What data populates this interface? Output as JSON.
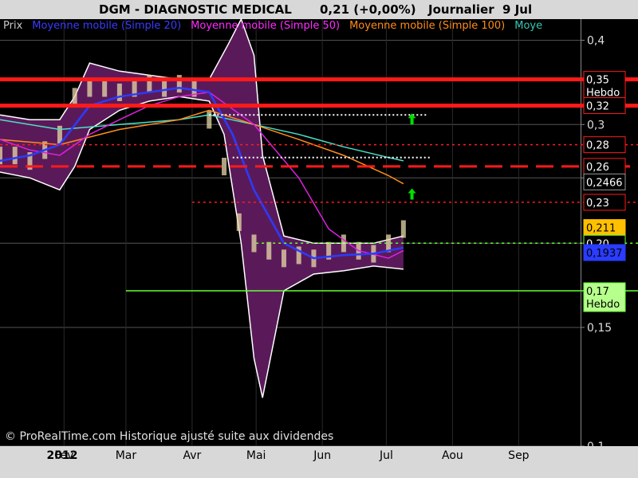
{
  "header": {
    "symbol": "DGM - DIAGNOSTIC MEDICAL",
    "price": "0,21 (+0,00%)",
    "period": "Journalier  9 Jul"
  },
  "legend": [
    {
      "label": "Prix",
      "color": "#c8c8c8"
    },
    {
      "label": "Moyenne mobile (Simple 20)",
      "color": "#3a3aff"
    },
    {
      "label": "Moyenne mobile (Simple 50)",
      "color": "#ff2dff"
    },
    {
      "label": "Moyenne mobile (Simple 100)",
      "color": "#ff8c1a"
    },
    {
      "label": "Moye",
      "color": "#33c8b4"
    }
  ],
  "watermark": "© ProRealTime.com Historique ajusté suite aux dividendes",
  "colors": {
    "band_fill": "#5a1a5a",
    "price_bars": "#e8d9a8",
    "sma20": "#2a3cff",
    "sma50": "#e020e0",
    "sma100": "#ff8c1a",
    "sma200": "#4ae0c8",
    "resistance": "#ff1a1a",
    "support": "#66ff33",
    "arrow": "#00e000"
  },
  "chart_data": {
    "type": "line",
    "title": "DGM - DIAGNOSTIC MEDICAL",
    "scale": "log",
    "ylim": [
      0.1,
      0.43
    ],
    "xlim": [
      "2012-01-02",
      "2012-09-30"
    ],
    "x_ticks": [
      {
        "label": "2012",
        "date": "2012-01-02",
        "bold": true
      },
      {
        "label": "Fev",
        "date": "2012-02-01"
      },
      {
        "label": "Mar",
        "date": "2012-03-01"
      },
      {
        "label": "Avr",
        "date": "2012-04-01"
      },
      {
        "label": "Mai",
        "date": "2012-05-01"
      },
      {
        "label": "Jun",
        "date": "2012-06-01"
      },
      {
        "label": "Jul",
        "date": "2012-07-01"
      },
      {
        "label": "Aou",
        "date": "2012-08-01"
      },
      {
        "label": "Sep",
        "date": "2012-09-01"
      }
    ],
    "y_ticks": [
      "0,1",
      "0,15",
      "0,2",
      "0,25",
      "0,3",
      "0,35",
      "0,4"
    ],
    "y_tick_values": [
      0.1,
      0.15,
      0.2,
      0.25,
      0.3,
      0.35,
      0.4
    ],
    "price": {
      "x": [
        "2012-01-02",
        "2012-01-09",
        "2012-01-16",
        "2012-01-23",
        "2012-01-30",
        "2012-02-06",
        "2012-02-13",
        "2012-02-20",
        "2012-02-27",
        "2012-03-05",
        "2012-03-12",
        "2012-03-19",
        "2012-03-26",
        "2012-04-02",
        "2012-04-09",
        "2012-04-16",
        "2012-04-23",
        "2012-04-30",
        "2012-05-07",
        "2012-05-14",
        "2012-05-21",
        "2012-05-28",
        "2012-06-04",
        "2012-06-11",
        "2012-06-18",
        "2012-06-25",
        "2012-07-02",
        "2012-07-09"
      ],
      "close": [
        0.27,
        0.27,
        0.265,
        0.275,
        0.29,
        0.33,
        0.34,
        0.34,
        0.335,
        0.34,
        0.345,
        0.34,
        0.345,
        0.34,
        0.305,
        0.26,
        0.215,
        0.2,
        0.195,
        0.19,
        0.192,
        0.19,
        0.195,
        0.2,
        0.195,
        0.193,
        0.2,
        0.21
      ]
    },
    "series": [
      {
        "name": "Moyenne mobile (Simple 20)",
        "color": "#2a3cff",
        "x": [
          "2012-01-02",
          "2012-01-16",
          "2012-01-30",
          "2012-02-13",
          "2012-02-27",
          "2012-03-12",
          "2012-03-26",
          "2012-04-09",
          "2012-04-20",
          "2012-04-30",
          "2012-05-14",
          "2012-05-28",
          "2012-06-11",
          "2012-06-25",
          "2012-07-09"
        ],
        "values": [
          0.265,
          0.27,
          0.28,
          0.32,
          0.33,
          0.335,
          0.34,
          0.335,
          0.29,
          0.24,
          0.2,
          0.19,
          0.192,
          0.193,
          0.197
        ]
      },
      {
        "name": "Moyenne mobile (Simple 50)",
        "color": "#e020e0",
        "x": [
          "2012-01-02",
          "2012-01-16",
          "2012-01-30",
          "2012-02-13",
          "2012-02-27",
          "2012-03-12",
          "2012-03-26",
          "2012-04-09",
          "2012-04-30",
          "2012-05-21",
          "2012-06-04",
          "2012-06-18",
          "2012-07-02",
          "2012-07-09"
        ],
        "values": [
          0.285,
          0.275,
          0.27,
          0.29,
          0.305,
          0.32,
          0.33,
          0.335,
          0.3,
          0.25,
          0.21,
          0.195,
          0.19,
          0.195
        ]
      },
      {
        "name": "Moyenne mobile (Simple 100)",
        "color": "#ff8c1a",
        "x": [
          "2012-01-02",
          "2012-01-30",
          "2012-02-27",
          "2012-03-26",
          "2012-04-09",
          "2012-04-30",
          "2012-05-21",
          "2012-06-11",
          "2012-07-02",
          "2012-07-09"
        ],
        "values": [
          0.285,
          0.28,
          0.295,
          0.305,
          0.315,
          0.3,
          0.285,
          0.27,
          0.252,
          0.245
        ]
      },
      {
        "name": "Moye",
        "color": "#4ae0c8",
        "x": [
          "2012-01-02",
          "2012-01-30",
          "2012-02-27",
          "2012-03-26",
          "2012-04-09",
          "2012-04-30",
          "2012-05-21",
          "2012-06-11",
          "2012-07-02",
          "2012-07-09"
        ],
        "values": [
          0.305,
          0.295,
          0.3,
          0.305,
          0.31,
          0.3,
          0.29,
          0.278,
          0.268,
          0.265
        ]
      }
    ],
    "bollinger_upper": {
      "x": [
        "2012-01-02",
        "2012-01-16",
        "2012-01-30",
        "2012-02-06",
        "2012-02-13",
        "2012-02-27",
        "2012-03-12",
        "2012-03-26",
        "2012-04-09",
        "2012-04-18",
        "2012-04-24",
        "2012-04-30",
        "2012-05-04",
        "2012-05-14",
        "2012-05-28",
        "2012-06-11",
        "2012-06-25",
        "2012-07-09"
      ],
      "values": [
        0.31,
        0.305,
        0.305,
        0.33,
        0.37,
        0.36,
        0.355,
        0.35,
        0.35,
        0.395,
        0.43,
        0.38,
        0.27,
        0.205,
        0.2,
        0.2,
        0.2,
        0.205
      ]
    },
    "bollinger_lower": {
      "x": [
        "2012-01-02",
        "2012-01-16",
        "2012-01-30",
        "2012-02-06",
        "2012-02-13",
        "2012-02-27",
        "2012-03-12",
        "2012-03-26",
        "2012-04-09",
        "2012-04-16",
        "2012-04-24",
        "2012-04-30",
        "2012-05-04",
        "2012-05-14",
        "2012-05-28",
        "2012-06-11",
        "2012-06-25",
        "2012-07-09"
      ],
      "values": [
        0.255,
        0.25,
        0.24,
        0.26,
        0.295,
        0.315,
        0.325,
        0.33,
        0.325,
        0.29,
        0.2,
        0.135,
        0.118,
        0.17,
        0.18,
        0.182,
        0.185,
        0.183
      ]
    },
    "levels": [
      {
        "value": 0.35,
        "label": "0,35 Hebdo",
        "style": "solid",
        "color": "#ff1a1a",
        "bg": "#000000",
        "fg": "#ffffff"
      },
      {
        "value": 0.32,
        "label": "0,32",
        "style": "solid",
        "color": "#ff1a1a",
        "bg": "#000000",
        "fg": "#ffffff"
      },
      {
        "value": 0.28,
        "label": "0,28",
        "style": "dotted",
        "color": "#ff1a1a",
        "bg": "#000000",
        "fg": "#ffffff"
      },
      {
        "value": 0.26,
        "label": "0,26 Hebdo",
        "style": "dashed",
        "color": "#ff1a1a",
        "bg": "#000000",
        "fg": "#ffffff"
      },
      {
        "value": 0.2466,
        "label": "0,2466",
        "style": "none",
        "color": "#999999",
        "bg": "#000000",
        "fg": "#ffffff"
      },
      {
        "value": 0.23,
        "label": "0,23",
        "style": "dotted",
        "color": "#ff1a1a",
        "bg": "#000000",
        "fg": "#ffffff"
      },
      {
        "value": 0.211,
        "label": "0,211",
        "style": "none",
        "color": "#ffc000",
        "bg": "#ffc000",
        "fg": "#000000"
      },
      {
        "value": 0.2,
        "label": "0,20",
        "style": "dotted",
        "color": "#66ff33",
        "bg": "#000000",
        "fg": "#ffffff"
      },
      {
        "value": 0.1937,
        "label": "0,1937",
        "style": "none",
        "color": "#2a3cff",
        "bg": "#2a3cff",
        "fg": "#000000"
      },
      {
        "value": 0.17,
        "label": "0,17 Hebdo",
        "style": "solid",
        "color": "#66ff33",
        "bg": "#b6ff8c",
        "fg": "#000000"
      }
    ],
    "white_dotted_segments": [
      {
        "value": 0.31,
        "from": "2012-04-09",
        "to": "2012-07-20"
      },
      {
        "value": 0.268,
        "from": "2012-04-20",
        "to": "2012-07-22"
      }
    ],
    "arrows": [
      {
        "date": "2012-07-13",
        "value": 0.305
      },
      {
        "date": "2012-07-13",
        "value": 0.236
      }
    ]
  }
}
